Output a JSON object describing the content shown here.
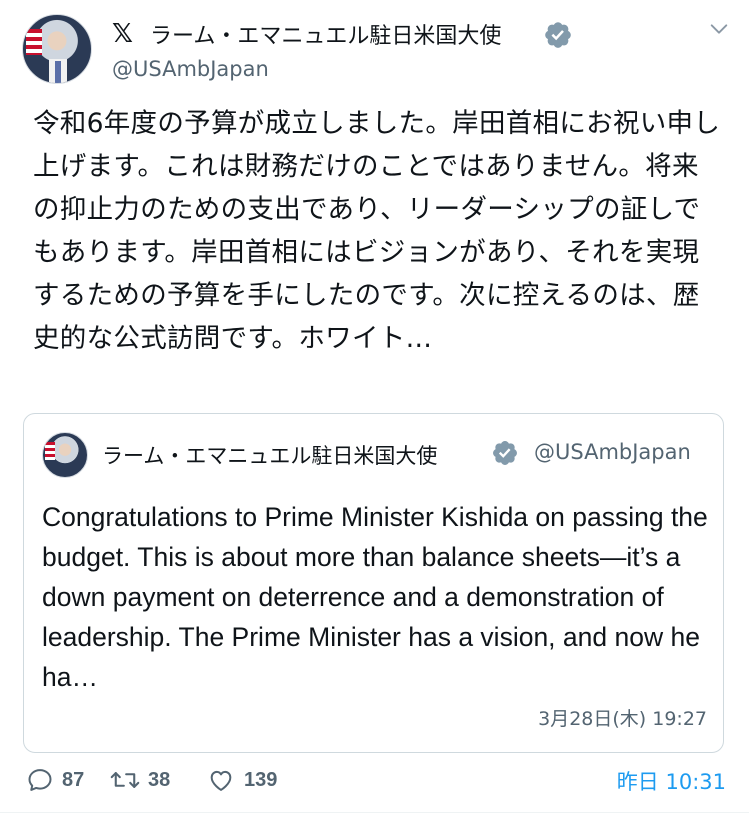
{
  "author": {
    "display_name": "ラーム・エマニュエル駐日米国大使",
    "handle": "@USAmbJapan",
    "verified": true,
    "platform_icon": "x-logo-icon"
  },
  "tweet": {
    "text": "令和6年度の予算が成立しました。岸田首相にお祝い申し上げます。これは財務だけのことではありません。将来の抑止力のための支出であり、リーダーシップの証しでもあります。岸田首相にはビジョンがあり、それを実現するための予算を手にしたのです。次に控えるのは、歴史的な公式訪問です。ホワイト…",
    "timestamp": "昨日 10:31"
  },
  "quoted_tweet": {
    "display_name": "ラーム・エマニュエル駐日米国大使",
    "handle": "@USAmbJapan",
    "verified": true,
    "text": "Congratulations to Prime Minister Kishida on passing the budget. This is about more than balance sheets—it’s a down payment on deterrence and a demonstration of leadership. The Prime Minister has a vision, and now he ha…",
    "timestamp": "3月28日(木) 19:27"
  },
  "actions": {
    "reply_count": "87",
    "retweet_count": "38",
    "like_count": "139"
  },
  "colors": {
    "text": "#0f1419",
    "secondary": "#536471",
    "accent": "#1d9bf0",
    "border": "#cfd9de",
    "verified_badge": "#829aab"
  }
}
